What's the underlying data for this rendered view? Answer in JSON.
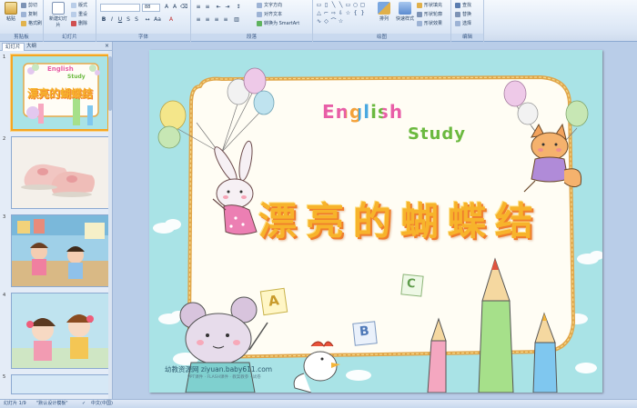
{
  "ribbon": {
    "groups": {
      "clipboard": {
        "label": "剪贴板",
        "paste": "粘贴",
        "cut": "剪切",
        "copy": "复制",
        "format_painter": "格式刷"
      },
      "slides": {
        "label": "幻灯片",
        "new_slide": "新建幻灯片",
        "layout": "版式",
        "reset": "重设",
        "delete": "删除"
      },
      "font": {
        "label": "字体",
        "font_size": "88"
      },
      "paragraph": {
        "label": "段落",
        "text_direction": "文字方向",
        "align_text": "对齐文本",
        "smartart": "转换为 SmartArt"
      },
      "drawing": {
        "label": "绘图",
        "arrange": "排列",
        "quick_styles": "快速样式",
        "shape_fill": "形状填充",
        "shape_outline": "形状轮廓",
        "shape_effects": "形状效果"
      },
      "editing": {
        "label": "编辑",
        "find": "查找",
        "replace": "替换",
        "select": "选择"
      }
    }
  },
  "pane": {
    "tabs": [
      "幻灯片",
      "大纲"
    ],
    "close": "×",
    "thumbnails": [
      {
        "num": "1",
        "title": "漂亮的蝴蝶结",
        "english": "English",
        "study": "Study"
      },
      {
        "num": "2"
      },
      {
        "num": "3"
      },
      {
        "num": "4"
      },
      {
        "num": "5"
      }
    ]
  },
  "slide": {
    "english": "English",
    "study": "Study",
    "title": "漂亮的蝴蝶结",
    "letters": [
      "A",
      "B",
      "C"
    ],
    "watermark": "幼教资源网 ziyuan.baby611.com",
    "watermark_sub": "PPT课件 · FLASH课件 · 教案教参 · 试卷"
  },
  "status": {
    "slide_indicator": "幻灯片 1/9",
    "theme": "\"默认设计模板\"",
    "language": "中文(中国)"
  },
  "colors": {
    "ribbon_bg": "#dde8f6",
    "slide_bg": "#a9e3e6",
    "title": "#f7b32b",
    "title_outline": "#ef7d2c",
    "selected_thumb": "#f5a623"
  }
}
